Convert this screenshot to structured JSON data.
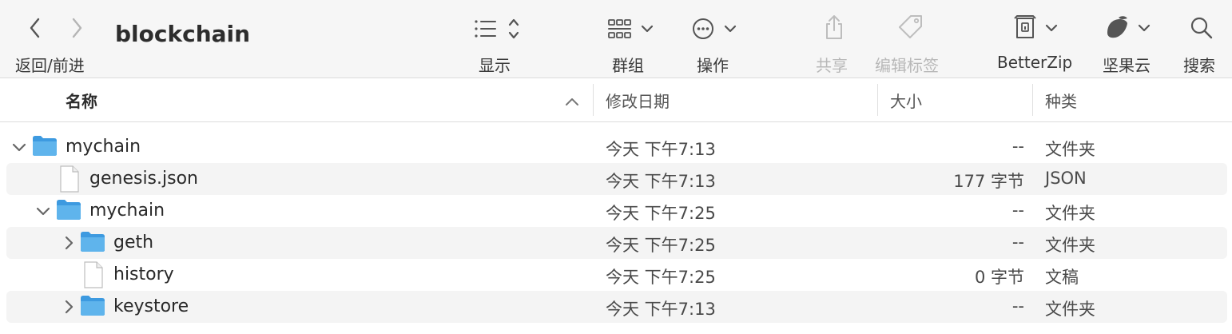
{
  "toolbar": {
    "back_forward_label": "返回/前进",
    "title": "blockchain",
    "view_label": "显示",
    "group_label": "群组",
    "action_label": "操作",
    "share_label": "共享",
    "tags_label": "编辑标签",
    "betterzip_label": "BetterZip",
    "jianguoyun_label": "坚果云",
    "search_label": "搜索"
  },
  "columns": {
    "name": "名称",
    "modified": "修改日期",
    "size": "大小",
    "kind": "种类"
  },
  "rows": [
    {
      "name": "mychain",
      "date": "今天 下午7:13",
      "size": "--",
      "kind": "文件夹",
      "type": "folder",
      "expanded": true
    },
    {
      "name": "genesis.json",
      "date": "今天 下午7:13",
      "size": "177 字节",
      "kind": "JSON",
      "type": "file"
    },
    {
      "name": "mychain",
      "date": "今天 下午7:25",
      "size": "--",
      "kind": "文件夹",
      "type": "folder",
      "expanded": true
    },
    {
      "name": "geth",
      "date": "今天 下午7:25",
      "size": "--",
      "kind": "文件夹",
      "type": "folder",
      "expanded": false
    },
    {
      "name": "history",
      "date": "今天 下午7:25",
      "size": "0 字节",
      "kind": "文稿",
      "type": "file"
    },
    {
      "name": "keystore",
      "date": "今天 下午7:13",
      "size": "--",
      "kind": "文件夹",
      "type": "folder",
      "expanded": false
    }
  ],
  "colors": {
    "folder": "#5fb4ec",
    "folder_dark": "#3d9ae0",
    "alt_row": "#f4f4f4",
    "toolbar_bg": "#f6f6f6"
  }
}
